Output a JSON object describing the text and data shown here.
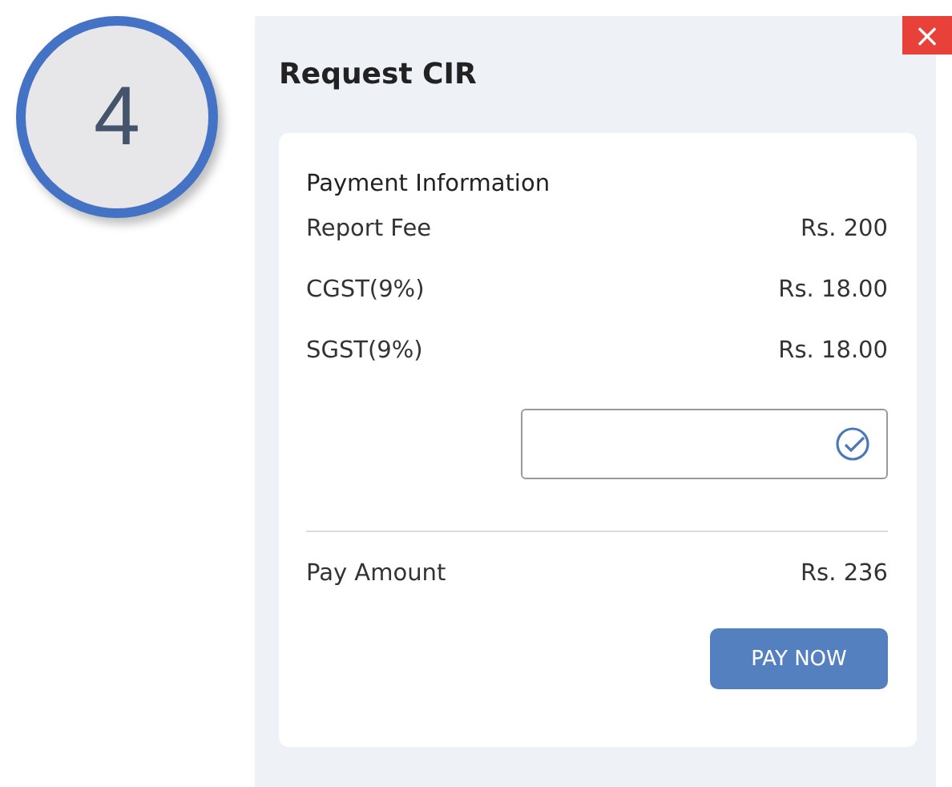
{
  "step": {
    "number": "4"
  },
  "dialog": {
    "title": "Request CIR",
    "close": "×",
    "section_title": "Payment Information",
    "fees": [
      {
        "label": "Report Fee",
        "value": "Rs. 200"
      },
      {
        "label": "CGST(9%)",
        "value": "Rs. 18.00"
      },
      {
        "label": "SGST(9%)",
        "value": "Rs. 18.00"
      }
    ],
    "total": {
      "label": "Pay Amount",
      "value": "Rs. 236"
    },
    "button": "PAY NOW"
  }
}
